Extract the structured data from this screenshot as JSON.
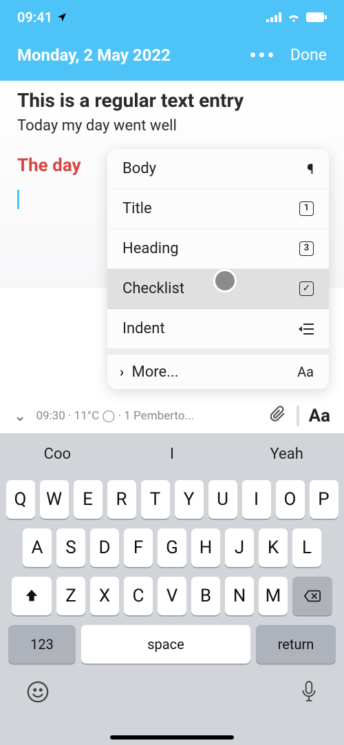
{
  "status": {
    "time": "09:41"
  },
  "header": {
    "date": "Monday, 2 May 2022",
    "done": "Done"
  },
  "note": {
    "title": "This is a regular text entry",
    "body": "Today my day went well",
    "subheading": "The day"
  },
  "format_menu": {
    "body": {
      "label": "Body",
      "icon": "¶"
    },
    "title": {
      "label": "Title",
      "icon": "1"
    },
    "heading": {
      "label": "Heading",
      "icon": "3"
    },
    "checklist": {
      "label": "Checklist",
      "icon": "✓"
    },
    "indent": {
      "label": "Indent",
      "icon": "⇥"
    },
    "more": {
      "label": "More...",
      "icon": "Aa"
    }
  },
  "toolbar": {
    "info": "09:30  ·  11°C ◯  ·  1 Pemberto...",
    "aa": "Aa"
  },
  "suggestions": [
    "Coo",
    "I",
    "Yeah"
  ],
  "keys": {
    "row1": [
      "Q",
      "W",
      "E",
      "R",
      "T",
      "Y",
      "U",
      "I",
      "O",
      "P"
    ],
    "row2": [
      "A",
      "S",
      "D",
      "F",
      "G",
      "H",
      "J",
      "K",
      "L"
    ],
    "row3": [
      "Z",
      "X",
      "C",
      "V",
      "B",
      "N",
      "M"
    ],
    "num": "123",
    "space": "space",
    "return": "return"
  }
}
